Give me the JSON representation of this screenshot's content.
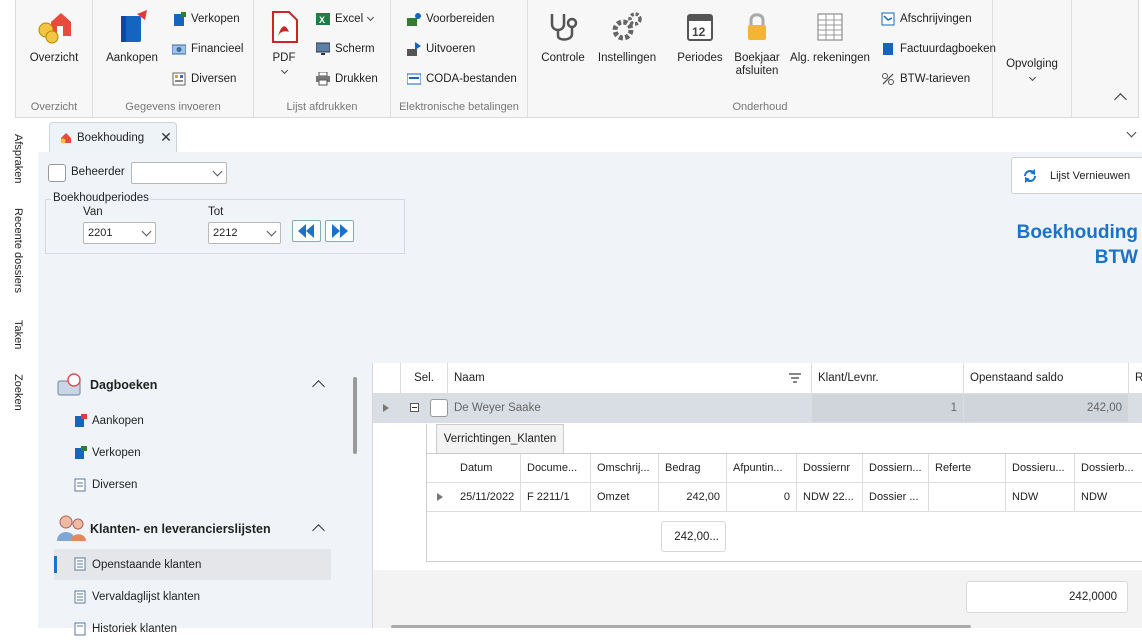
{
  "ribbon": {
    "groups": {
      "overzicht": "Overzicht",
      "gegevens": "Gegevens invoeren",
      "lijst": "Lijst afdrukken",
      "elektronisch": "Elektronische betalingen",
      "onderhoud": "Onderhoud"
    },
    "buttons": {
      "overzicht": "Overzicht",
      "aankopen": "Aankopen",
      "verkopen": "Verkopen",
      "financieel": "Financieel",
      "diversen": "Diversen",
      "pdf": "PDF",
      "excel": "Excel",
      "scherm": "Scherm",
      "drukken": "Drukken",
      "voorbereiden": "Voorbereiden",
      "uitvoeren": "Uitvoeren",
      "coda": "CODA-bestanden",
      "controle": "Controle",
      "instellingen": "Instellingen",
      "periodes": "Periodes",
      "boekjaar1": "Boekjaar",
      "boekjaar2": "afsluiten",
      "algrek": "Alg. rekeningen",
      "afschrijvingen": "Afschrijvingen",
      "factuurdagboeken": "Factuurdagboeken",
      "btwtarieven": "BTW-tarieven",
      "opvolging": "Opvolging"
    }
  },
  "sidetabs": [
    "Afspraken",
    "Recente dossiers",
    "Taken",
    "Zoeken"
  ],
  "doctab": {
    "label": "Boekhouding"
  },
  "filters": {
    "beheerder_label": "Beheerder",
    "beheerder_value": "",
    "periodes_label": "Boekhoudperiodes",
    "van_label": "Van",
    "van_value": "2201",
    "tot_label": "Tot",
    "tot_value": "2212",
    "refresh_label": "Lijst Vernieuwen"
  },
  "headline": {
    "line1": "Boekhouding",
    "line2": "BTW"
  },
  "nav": {
    "dagboeken": {
      "title": "Dagboeken",
      "items": [
        "Aankopen",
        "Verkopen",
        "Diversen"
      ]
    },
    "klanten": {
      "title": "Klanten- en leverancierslijsten",
      "items": [
        "Openstaande klanten",
        "Vervaldaglijst klanten",
        "Historiek klanten"
      ]
    }
  },
  "grid": {
    "columns": [
      "Sel.",
      "Naam",
      "Klant/Levnr.",
      "Openstaand saldo",
      "R"
    ],
    "row": {
      "naam": "De Weyer Saake",
      "klantnr": "1",
      "saldo": "242,00"
    },
    "subtab": "Verrichtingen_Klanten",
    "subcolumns": [
      "Datum",
      "Docume...",
      "Omschrij...",
      "Bedrag",
      "Afpuntin...",
      "Dossiernr",
      "Dossiern...",
      "Referte",
      "Dossieru...",
      "Dossierb..."
    ],
    "subrow": [
      "25/11/2022",
      "F 2211/1",
      "Omzet",
      "242,00",
      "0",
      "NDW 22...",
      "Dossier ...",
      "",
      "NDW",
      "NDW"
    ],
    "subtotal": "242,00...",
    "total": "242,0000"
  },
  "colors": {
    "accent": "#1a73c8",
    "sectionbg": "#f0f4f8"
  }
}
